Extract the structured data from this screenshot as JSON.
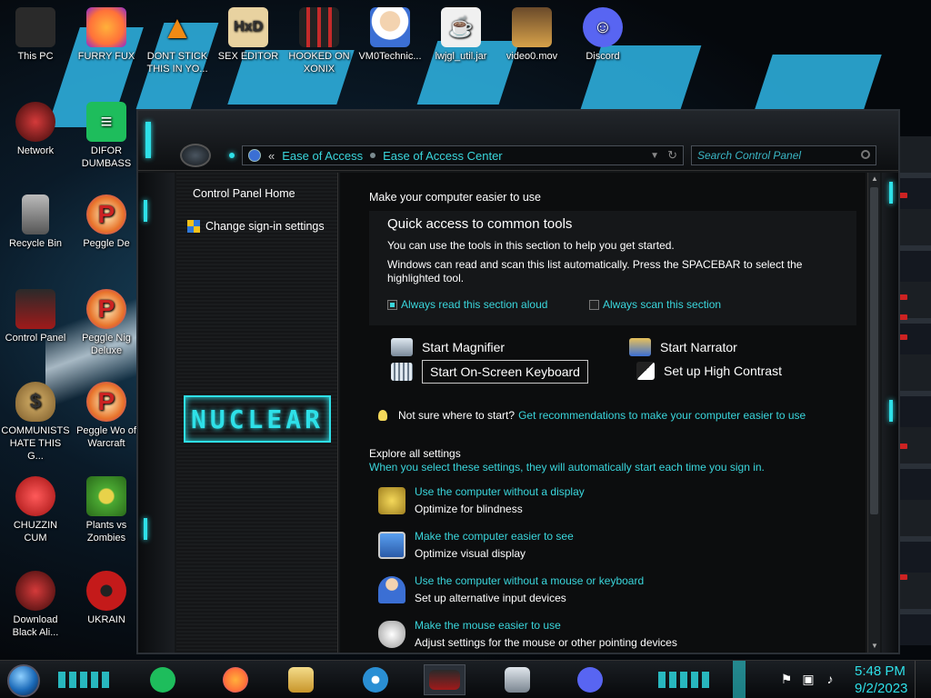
{
  "desktop_icons": [
    {
      "label": "This PC",
      "icon": "computer-icon",
      "color": "#2a2a2a"
    },
    {
      "label": "FURRY FUX",
      "icon": "firefox-icon",
      "color": "#ff7139"
    },
    {
      "label": "DONT STICK THIS IN YO...",
      "icon": "vlc-cone-icon",
      "color": "#f08a14"
    },
    {
      "label": "SEX EDITOR",
      "icon": "hxd-icon",
      "color": "#e0b66a"
    },
    {
      "label": "HOOKED ON XONIX",
      "icon": "xonix-icon",
      "color": "#c42a2a"
    },
    {
      "label": "VM0Technic...",
      "icon": "doctor-icon",
      "color": "#d8c6a8"
    },
    {
      "label": "lwjgl_util.jar",
      "icon": "java-icon",
      "color": "#f0f0f0"
    },
    {
      "label": "video0.mov",
      "icon": "video-icon",
      "color": "#d8a24a"
    },
    {
      "label": "Discord",
      "icon": "discord-icon",
      "color": "#5865f2"
    },
    {
      "label": "Network",
      "icon": "network-icon",
      "color": "#7a1a1a"
    },
    {
      "label": "DIFOR DUMBASS",
      "icon": "notes-icon",
      "color": "#1ebd5c"
    },
    {
      "label": "Recycle Bin",
      "icon": "recycle-bin-icon",
      "color": "#8a8a8a"
    },
    {
      "label": "Peggle De",
      "icon": "peggle-icon",
      "color": "#e8732a"
    },
    {
      "label": "Control Panel",
      "icon": "control-panel-icon",
      "color": "#a01a1a"
    },
    {
      "label": "Peggle Nig Deluxe",
      "icon": "peggle-icon",
      "color": "#e8732a"
    },
    {
      "label": "COMMUNISTS HATE THIS G...",
      "icon": "money-bag-icon",
      "color": "#b58c3a"
    },
    {
      "label": "Peggle Wo of Warcraft",
      "icon": "peggle-icon",
      "color": "#e8732a"
    },
    {
      "label": "CHUZZIN CUM",
      "icon": "chuzzle-icon",
      "color": "#d42020"
    },
    {
      "label": "Plants vs Zombies",
      "icon": "plants-vs-zombies-icon",
      "color": "#4aa832"
    },
    {
      "label": "Download Black Ali...",
      "icon": "network-icon",
      "color": "#7a1a1a"
    },
    {
      "label": "UKRAIN",
      "icon": "radiation-icon",
      "color": "#c41a1a"
    }
  ],
  "window": {
    "breadcrumb": [
      "Ease of Access",
      "Ease of Access Center"
    ],
    "breadcrumb_prefix": "«",
    "search_placeholder": "Search Control Panel",
    "left_pane": {
      "home_label": "Control Panel Home",
      "link_label": "Change sign-in settings",
      "logo_text": "NUCLEAR"
    },
    "content": {
      "subtitle": "Make your computer easier to use",
      "quick_access": {
        "title": "Quick access to common tools",
        "p1": "You can use the tools in this section to help you get started.",
        "p2": "Windows can read and scan this list automatically.  Press the SPACEBAR to select the highlighted tool.",
        "check_read": "Always read this section aloud",
        "check_read_checked": true,
        "check_scan": "Always scan this section",
        "check_scan_checked": false
      },
      "tools": {
        "magnifier": "Start Magnifier",
        "narrator": "Start Narrator",
        "osk": "Start On-Screen Keyboard",
        "high_contrast": "Set up High Contrast"
      },
      "tip": {
        "text": "Not sure where to start?",
        "link": "Get recommendations to make your computer easier to use"
      },
      "explore": {
        "title": "Explore all settings",
        "desc": "When you select these settings, they will automatically start each time you sign in."
      },
      "settings": [
        {
          "link": "Use the computer without a display",
          "desc": "Optimize for blindness",
          "icon": "display-lamp-icon"
        },
        {
          "link": "Make the computer easier to see",
          "desc": "Optimize visual display",
          "icon": "monitor-icon"
        },
        {
          "link": "Use the computer without a mouse or keyboard",
          "desc": "Set up alternative input devices",
          "icon": "person-headset-icon"
        },
        {
          "link": "Make the mouse easier to use",
          "desc": "Adjust settings for the mouse or other pointing devices",
          "icon": "mouse-icon"
        }
      ]
    }
  },
  "taskbar": {
    "apps": [
      {
        "name": "notes-taskbar-icon",
        "color": "#1ebd5c"
      },
      {
        "name": "firefox-taskbar-icon",
        "color": "#ff7139"
      },
      {
        "name": "file-explorer-taskbar-icon",
        "color": "#e8c15a"
      },
      {
        "name": "nuclear-app-taskbar-icon",
        "color": "#2a8fd4"
      },
      {
        "name": "control-panel-taskbar-icon",
        "color": "#a01a1a"
      },
      {
        "name": "performance-monitor-taskbar-icon",
        "color": "#9aa4ae"
      },
      {
        "name": "discord-taskbar-icon",
        "color": "#5865f2"
      }
    ],
    "clock_time": "5:48 PM",
    "clock_date": "9/2/2023"
  },
  "colors": {
    "accent": "#2ee0e8",
    "link": "#3ad6dc"
  }
}
